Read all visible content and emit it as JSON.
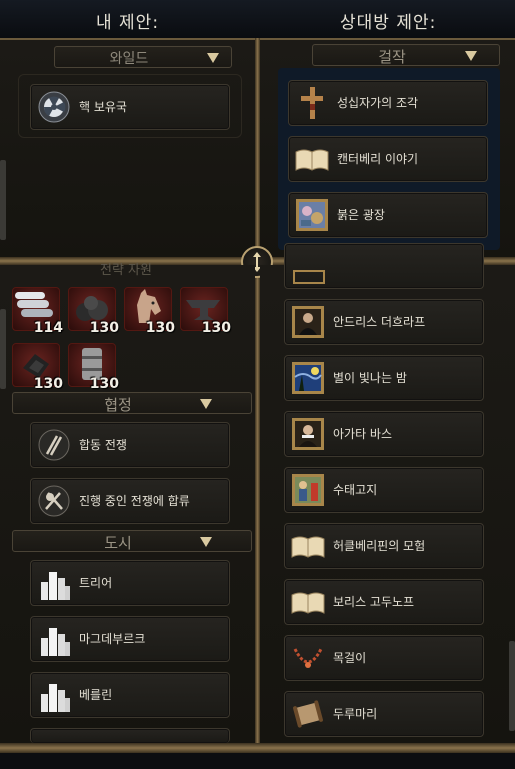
{
  "header": {
    "my_offer": "내 제안:",
    "their_offer": "상대방 제안:"
  },
  "left": {
    "world_section": "와일드",
    "world_items": [
      {
        "label": "핵 보유국",
        "icon": "nuclear-icon"
      }
    ],
    "resources_partial_header": "전략 자원",
    "resources": [
      {
        "name": "aluminum-icon",
        "count": "114"
      },
      {
        "name": "coal-icon",
        "count": "130"
      },
      {
        "name": "horse-icon",
        "count": "130"
      },
      {
        "name": "iron-icon",
        "count": "130"
      },
      {
        "name": "uranium-icon",
        "count": "130"
      },
      {
        "name": "oil-icon",
        "count": "130"
      }
    ],
    "agreements_section": "협정",
    "agreement_items": [
      {
        "label": "합동 전쟁",
        "icon": "joint-war-icon"
      },
      {
        "label": "진행 중인 전쟁에 합류",
        "icon": "join-war-icon"
      }
    ],
    "cities_section": "도시",
    "city_items": [
      {
        "label": "트리어",
        "icon": "city-icon"
      },
      {
        "label": "마그데부르크",
        "icon": "city-icon"
      },
      {
        "label": "베를린",
        "icon": "city-icon"
      }
    ]
  },
  "right": {
    "great_works_section": "걸작",
    "great_work_items": [
      {
        "label": "성십자가의 조각",
        "icon": "relic-cross-icon"
      },
      {
        "label": "캔터베리 이야기",
        "icon": "book-icon"
      },
      {
        "label": "붉은 광장",
        "icon": "painting-icon"
      }
    ],
    "lower_items": [
      {
        "label": "안드리스 더흐라프",
        "icon": "portrait-painting-icon"
      },
      {
        "label": "별이 빛나는 밤",
        "icon": "starry-night-painting-icon"
      },
      {
        "label": "아가타 바스",
        "icon": "portrait-painting-icon"
      },
      {
        "label": "수태고지",
        "icon": "annunciation-painting-icon"
      },
      {
        "label": "허클베리핀의 모험",
        "icon": "book-icon"
      },
      {
        "label": "보리스 고두노프",
        "icon": "book-icon"
      },
      {
        "label": "목걸이",
        "icon": "necklace-artifact-icon"
      },
      {
        "label": "두루마리",
        "icon": "scroll-artifact-icon"
      }
    ]
  },
  "colors": {
    "frame_gold": "#8a734c",
    "resource_red": "#6a2420",
    "panel_bg": "#1c1a16"
  }
}
